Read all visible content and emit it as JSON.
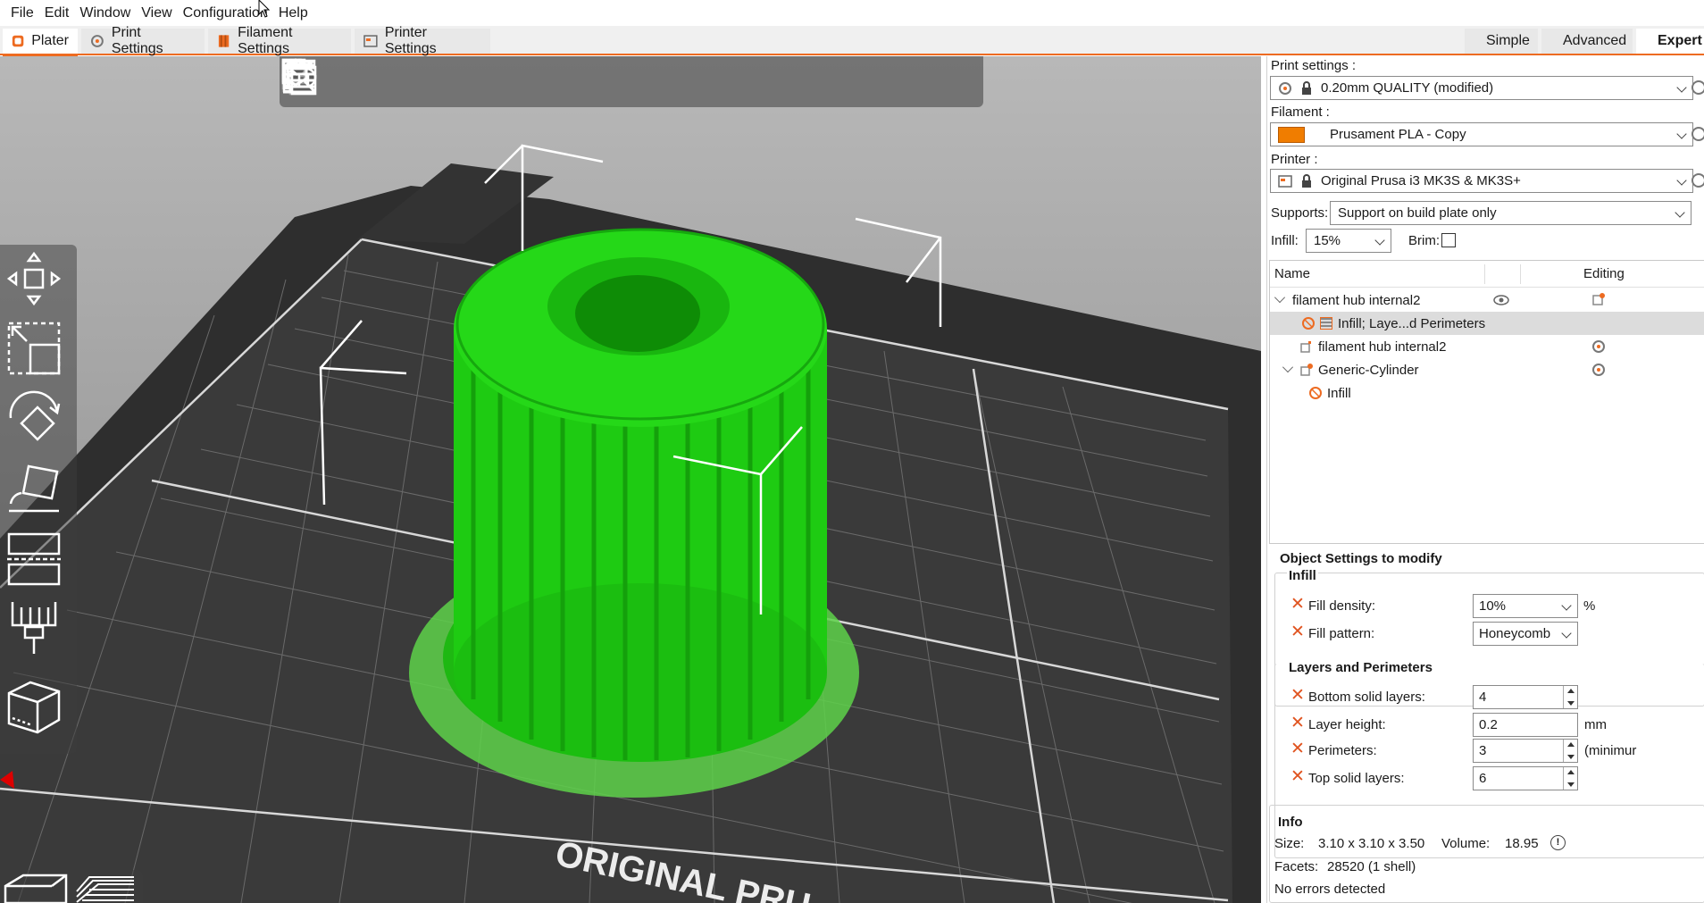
{
  "menu": [
    "File",
    "Edit",
    "Window",
    "View",
    "Configuration",
    "Help"
  ],
  "tabs": {
    "plater": "Plater",
    "print_settings": "Print Settings",
    "filament_settings": "Filament Settings",
    "printer_settings": "Printer Settings"
  },
  "modes": {
    "simple": "Simple",
    "advanced": "Advanced",
    "expert": "Expert",
    "colors": {
      "simple": "#3ec33e",
      "advanced": "#f0c000",
      "expert": "#e8131b"
    }
  },
  "sidebar": {
    "print_settings_label": "Print settings :",
    "print_settings_value": "0.20mm QUALITY (modified)",
    "filament_label": "Filament :",
    "filament_value": "Prusament PLA - Copy",
    "filament_color": "#f07d00",
    "printer_label": "Printer :",
    "printer_value": "Original Prusa i3 MK3S & MK3S+",
    "supports_label": "Supports:",
    "supports_value": "Support on build plate only",
    "infill_label": "Infill:",
    "infill_value": "15%",
    "brim_label": "Brim:"
  },
  "object_list": {
    "col_name": "Name",
    "col_editing": "Editing",
    "rows": [
      "filament hub internal2",
      "Infill; Laye...d Perimeters",
      "filament hub internal2",
      "Generic-Cylinder",
      "Infill"
    ]
  },
  "object_settings": {
    "title": "Object Settings to modify",
    "infill_group": "Infill",
    "fill_density_label": "Fill density:",
    "fill_density_value": "10%",
    "fill_density_unit": "%",
    "fill_pattern_label": "Fill pattern:",
    "fill_pattern_value": "Honeycomb",
    "layers_group": "Layers and Perimeters",
    "bottom_solid_label": "Bottom solid layers:",
    "bottom_solid_value": "4",
    "layer_height_label": "Layer height:",
    "layer_height_value": "0.2",
    "layer_height_unit": "mm",
    "perimeters_label": "Perimeters:",
    "perimeters_value": "3",
    "perimeters_unit": "(minimur",
    "top_solid_label": "Top solid layers:",
    "top_solid_value": "6"
  },
  "info": {
    "title": "Info",
    "size_label": "Size:",
    "size_value": "3.10 x 3.10 x 3.50",
    "volume_label": "Volume:",
    "volume_value": "18.95",
    "facets_label": "Facets:",
    "facets_value": "28520 (1 shell)",
    "errors": "No errors detected"
  },
  "viewport": {
    "bed_text": "ORIGINAL PRU",
    "model_color": "#1ecb12",
    "bed_color": "#3a3a3a"
  }
}
